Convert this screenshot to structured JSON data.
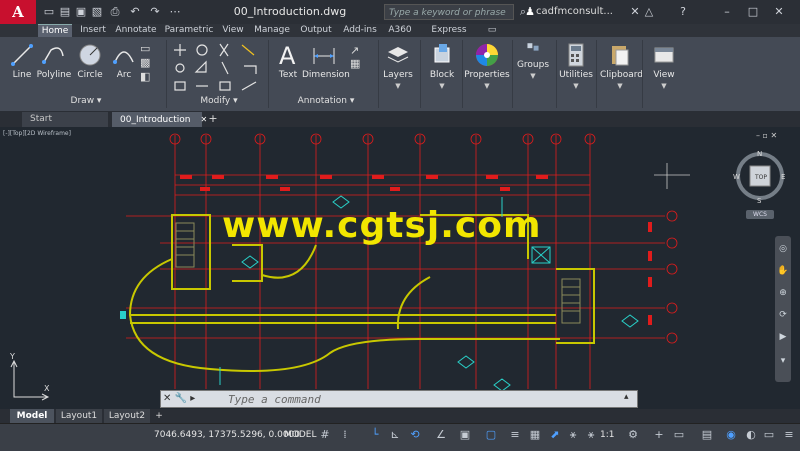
{
  "app": {
    "logo_text": "A",
    "document_title": "00_Introduction.dwg"
  },
  "search": {
    "placeholder": "Type a keyword or phrase"
  },
  "user": {
    "name": "cadfmconsult..."
  },
  "ribbon_tabs": [
    "Home",
    "Insert",
    "Annotate",
    "Parametric",
    "View",
    "Manage",
    "Output",
    "Add-ins",
    "A360",
    "Express Tools"
  ],
  "draw_tools": {
    "line": "Line",
    "polyline": "Polyline",
    "circle": "Circle",
    "arc": "Arc"
  },
  "annotation_tools": {
    "text": "Text",
    "dimension": "Dimension"
  },
  "groups": {
    "layers": "Layers",
    "block": "Block",
    "properties": "Properties",
    "groups": "Groups",
    "utilities": "Utilities",
    "clipboard": "Clipboard",
    "view": "View"
  },
  "panels": {
    "draw": "Draw",
    "modify": "Modify",
    "annotation": "Annotation"
  },
  "doc_tabs": [
    "Start",
    "00_Introduction"
  ],
  "viewport": {
    "label": "[-][Top][2D Wireframe]"
  },
  "viewcube": {
    "n": "N",
    "s": "S",
    "e": "E",
    "w": "W",
    "top": "TOP",
    "wcs": "WCS"
  },
  "watermark": "www.cgtsj.com",
  "command": {
    "placeholder": "Type a command"
  },
  "layout_tabs": [
    "Model",
    "Layout1",
    "Layout2"
  ],
  "status": {
    "coordinates": "7046.6493, 17375.5296, 0.0000",
    "model": "MODEL",
    "scale": "1:1"
  },
  "axis_labels": {
    "x": "X",
    "y": "Y"
  },
  "colors": {
    "cad_bg": "#212830",
    "grid_red": "#e01c1c",
    "wall_yellow": "#c8c800",
    "accent_cyan": "#29d0c8"
  }
}
